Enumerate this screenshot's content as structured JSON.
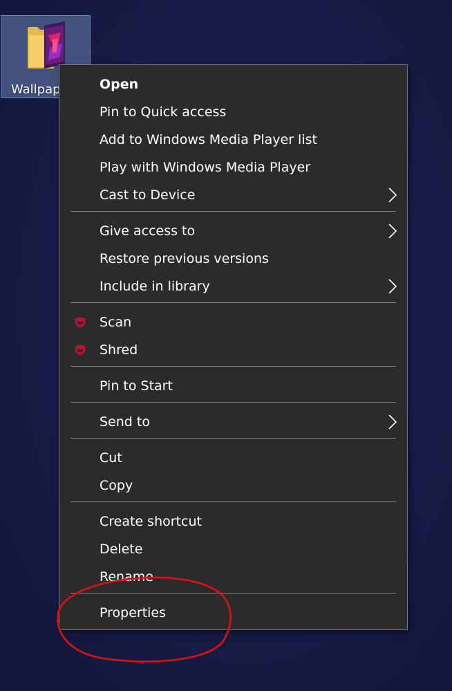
{
  "desktop": {
    "icon_label": "Wallpap",
    "icon_name": "folder-icon"
  },
  "menu": {
    "items": [
      {
        "label": "Open",
        "bold": true
      },
      {
        "label": "Pin to Quick access"
      },
      {
        "label": "Add to Windows Media Player list"
      },
      {
        "label": "Play with Windows Media Player"
      },
      {
        "label": "Cast to Device",
        "submenu": true
      },
      {
        "label": "Give access to",
        "submenu": true
      },
      {
        "label": "Restore previous versions"
      },
      {
        "label": "Include in library",
        "submenu": true
      },
      {
        "label": "Scan",
        "icon": "mcafee-shield-icon"
      },
      {
        "label": "Shred",
        "icon": "mcafee-shield-icon"
      },
      {
        "label": "Pin to Start"
      },
      {
        "label": "Send to",
        "submenu": true
      },
      {
        "label": "Cut"
      },
      {
        "label": "Copy"
      },
      {
        "label": "Create shortcut"
      },
      {
        "label": "Delete"
      },
      {
        "label": "Rename"
      },
      {
        "label": "Properties"
      }
    ]
  },
  "colors": {
    "menu_background": "#2b2b2b",
    "menu_text": "#ffffff",
    "separator": "#8a8a8a",
    "mcafee_red": "#c8102e",
    "annotation_red": "#e01010",
    "desktop_background": "#181d49"
  },
  "annotation": {
    "type": "hand-drawn circle",
    "target": "Properties"
  }
}
